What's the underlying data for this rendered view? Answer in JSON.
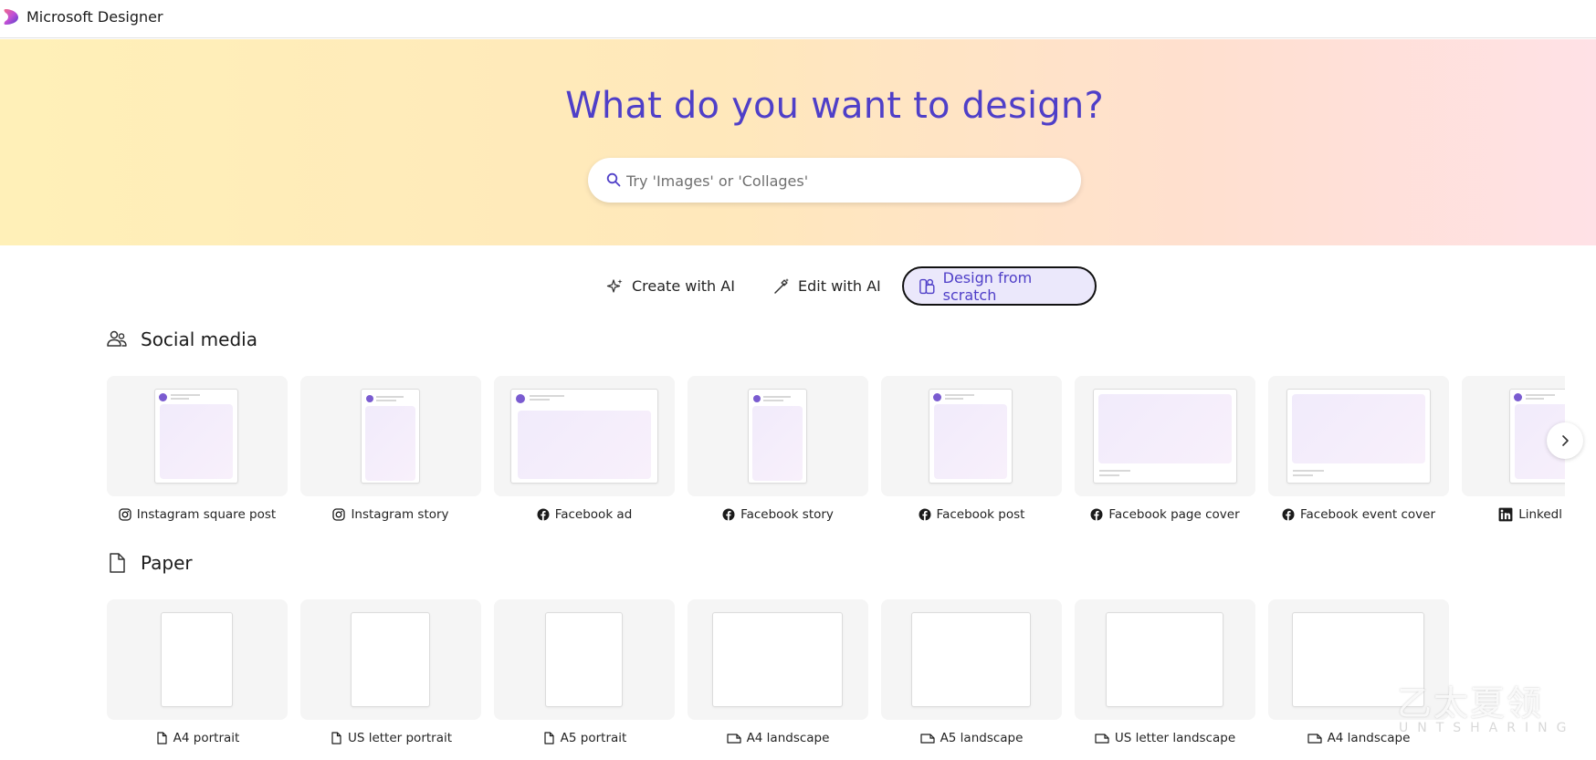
{
  "app": {
    "title": "Microsoft Designer"
  },
  "hero": {
    "title": "What do you want to design?",
    "search_placeholder": "Try 'Images' or 'Collages'"
  },
  "modes": [
    {
      "label": "Create with AI",
      "icon": "sparkle-icon"
    },
    {
      "label": "Edit with AI",
      "icon": "magic-wand-icon"
    },
    {
      "label": "Design from scratch",
      "icon": "shapes-icon",
      "selected": true
    }
  ],
  "social": {
    "title": "Social media",
    "items": [
      {
        "label": "Instagram square post",
        "icon": "instagram-icon"
      },
      {
        "label": "Instagram story",
        "icon": "instagram-icon"
      },
      {
        "label": "Facebook ad",
        "icon": "facebook-icon"
      },
      {
        "label": "Facebook story",
        "icon": "facebook-icon"
      },
      {
        "label": "Facebook post",
        "icon": "facebook-icon"
      },
      {
        "label": "Facebook page cover",
        "icon": "facebook-icon"
      },
      {
        "label": "Facebook event cover",
        "icon": "facebook-icon"
      },
      {
        "label": "Linkedl",
        "icon": "linkedin-icon"
      }
    ]
  },
  "paper": {
    "title": "Paper",
    "items": [
      {
        "label": "A4 portrait",
        "icon": "document-portrait-icon"
      },
      {
        "label": "US letter portrait",
        "icon": "document-portrait-icon"
      },
      {
        "label": "A5 portrait",
        "icon": "document-portrait-icon"
      },
      {
        "label": "A4 landscape",
        "icon": "document-landscape-icon"
      },
      {
        "label": "A5 landscape",
        "icon": "document-landscape-icon"
      },
      {
        "label": "US letter landscape",
        "icon": "document-landscape-icon"
      },
      {
        "label": "A4 landscape",
        "icon": "document-landscape-icon"
      }
    ]
  },
  "watermark": {
    "main": "乙太夏领",
    "sub": "UNTSHARING"
  },
  "colors": {
    "accent": "#4f3fc8",
    "selected_bg": "#ebe8fb",
    "card_bg": "#f5f5f5"
  }
}
